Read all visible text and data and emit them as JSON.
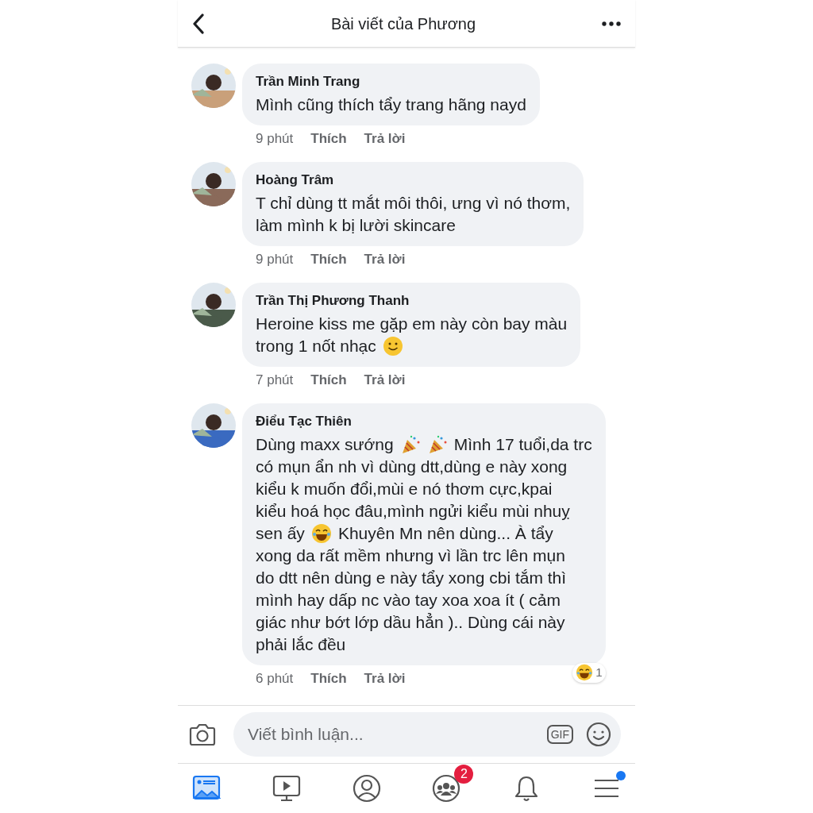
{
  "header": {
    "title": "Bài viết của Phương"
  },
  "comments": [
    {
      "name": "Trần Minh Trang",
      "lines": [
        [
          {
            "kind": "text",
            "text": "Mình cũng thích tẩy trang hãng nayd"
          }
        ]
      ],
      "time": "9 phút",
      "like": "Thích",
      "reply": "Trả lời"
    },
    {
      "name": "Hoàng Trâm",
      "lines": [
        [
          {
            "kind": "text",
            "text": "T chỉ dùng tt mắt môi thôi, ưng vì nó thơm,"
          }
        ],
        [
          {
            "kind": "text",
            "text": "làm mình k bị lười skincare"
          }
        ]
      ],
      "time": "9 phút",
      "like": "Thích",
      "reply": "Trả lời"
    },
    {
      "name": "Trần Thị Phương Thanh",
      "lines": [
        [
          {
            "kind": "text",
            "text": "Heroine kiss me gặp em này còn bay màu"
          }
        ],
        [
          {
            "kind": "text",
            "text": "trong 1 nốt nhạc"
          },
          {
            "kind": "smile"
          }
        ]
      ],
      "time": "7 phút",
      "like": "Thích",
      "reply": "Trả lời"
    },
    {
      "name": "Điểu Tạc Thiên",
      "lines": [
        [
          {
            "kind": "text",
            "text": "Dùng maxx sướng"
          },
          {
            "kind": "party"
          },
          {
            "kind": "party"
          },
          {
            "kind": "text",
            "text": "Mình 17 tuổi,da trc"
          }
        ],
        [
          {
            "kind": "text",
            "text": "có mụn ẩn nh vì dùng dtt,dùng e này xong"
          }
        ],
        [
          {
            "kind": "text",
            "text": "kiểu k muốn đổi,mùi e nó thơm cực,kpai"
          }
        ],
        [
          {
            "kind": "text",
            "text": "kiểu hoá học đâu,mình ngửi kiểu mùi nhuỵ"
          }
        ],
        [
          {
            "kind": "text",
            "text": "sen ấy"
          },
          {
            "kind": "laugh"
          },
          {
            "kind": "text",
            "text": "Khuyên Mn nên dùng... À tẩy"
          }
        ],
        [
          {
            "kind": "text",
            "text": "xong da rất mềm nhưng vì lần trc lên mụn"
          }
        ],
        [
          {
            "kind": "text",
            "text": "do dtt nên dùng e này tẩy xong cbi tắm thì"
          }
        ],
        [
          {
            "kind": "text",
            "text": "mình hay dấp nc vào tay xoa xoa ít ( cảm"
          }
        ],
        [
          {
            "kind": "text",
            "text": "giác như bớt lớp dầu hẳn ).. Dùng cái này"
          }
        ],
        [
          {
            "kind": "text",
            "text": "phải lắc đều"
          }
        ]
      ],
      "time": "6 phút",
      "like": "Thích",
      "reply": "Trả lời",
      "reaction": {
        "count": "1"
      }
    }
  ],
  "composer": {
    "placeholder": "Viết bình luận...",
    "gif": "GIF"
  },
  "tabs": [
    {
      "kind": "news",
      "selected": true
    },
    {
      "kind": "video",
      "selected": false
    },
    {
      "kind": "profile",
      "selected": false
    },
    {
      "kind": "groups",
      "selected": false,
      "badge": "2"
    },
    {
      "kind": "bell",
      "selected": false
    },
    {
      "kind": "menu",
      "selected": false,
      "dot": true
    }
  ]
}
